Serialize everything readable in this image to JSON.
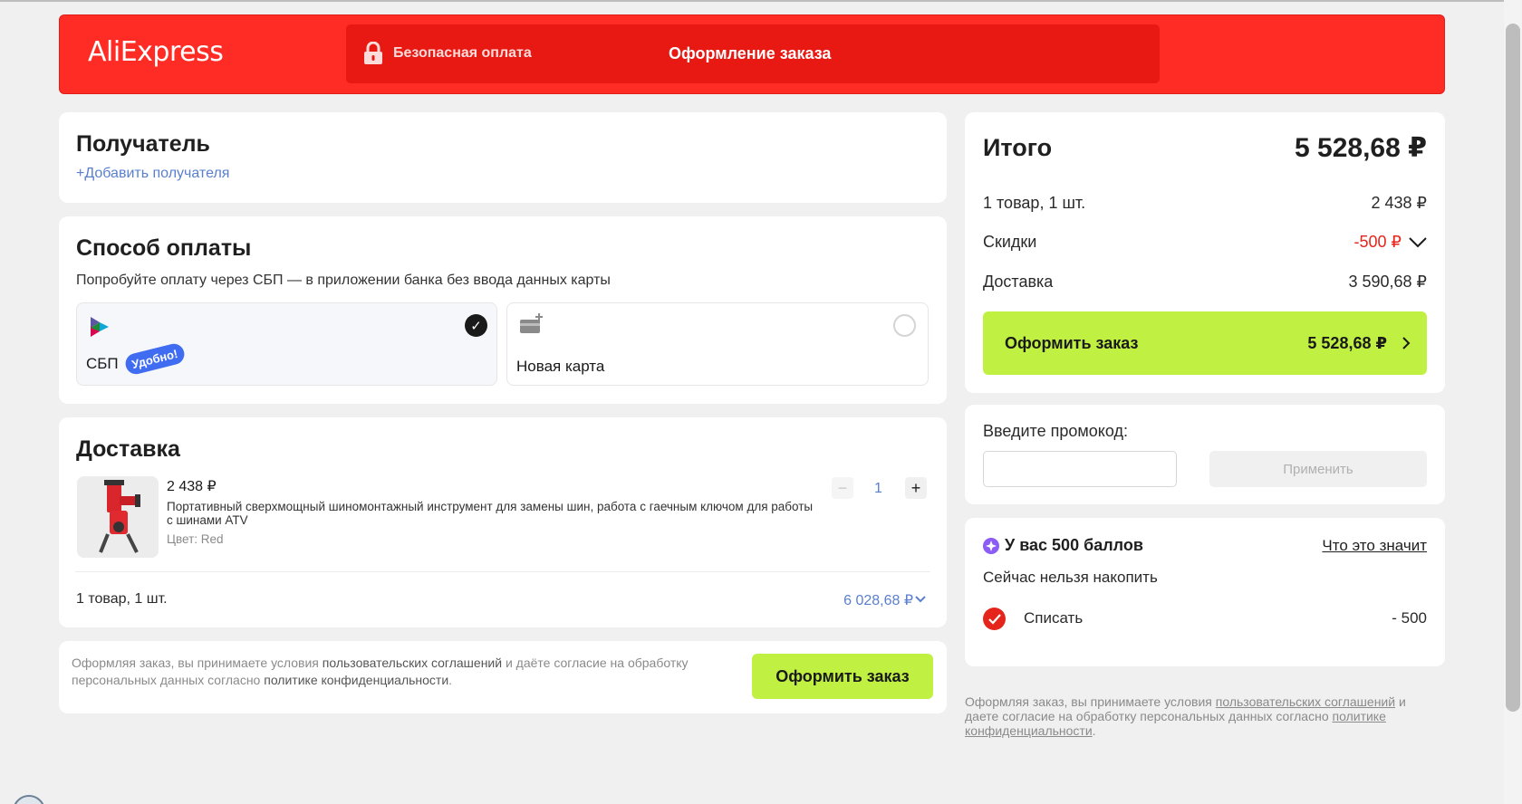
{
  "header": {
    "logo": "AliExpress",
    "secure_payment": "Безопасная оплата",
    "page_title": "Оформление заказа"
  },
  "recipient": {
    "title": "Получатель",
    "add_link": "+Добавить получателя"
  },
  "payment": {
    "title": "Способ оплаты",
    "hint": "Попробуйте оплату через СБП — в приложении банка без ввода данных карты",
    "options": [
      {
        "label": "СБП",
        "badge": "Удобно!",
        "selected": true,
        "icon": "sbp-icon"
      },
      {
        "label": "Новая карта",
        "selected": false,
        "icon": "new-card-icon"
      }
    ]
  },
  "delivery": {
    "title": "Доставка",
    "item": {
      "price": "2 438 ₽",
      "name": "Портативный сверхмощный шиномонтажный инструмент для замены шин, работа с гаечным ключом для работы с шинами ATV",
      "color_label": "Цвет: Red",
      "quantity": "1",
      "minus": "−",
      "plus": "+"
    },
    "summary_count": "1 товар, 1 шт.",
    "summary_total": "6 028,68 ₽"
  },
  "agreement": {
    "text_1": "Оформляя заказ, вы принимаете условия ",
    "link_1": "пользовательских соглашений",
    "text_2": " и даёте согласие на обработку персональных данных согласно ",
    "link_2": "политике конфиденциальности",
    "text_3": ".",
    "button": "Оформить заказ"
  },
  "summary": {
    "title": "Итого",
    "total": "5 528,68 ₽",
    "rows": [
      {
        "label": "1 товар, 1 шт.",
        "value": "2 438 ₽"
      },
      {
        "label": "Скидки",
        "value": "-500 ₽"
      },
      {
        "label": "Доставка",
        "value": "3 590,68 ₽"
      }
    ],
    "button_label": "Оформить заказ",
    "button_amount": "5 528,68 ₽"
  },
  "promo": {
    "label": "Введите промокод:",
    "input_value": "",
    "input_placeholder": "",
    "apply": "Применить"
  },
  "points": {
    "title": "У вас 500 баллов",
    "what_link": "Что это значит",
    "note": "Сейчас нельзя накопить",
    "spend_label": "Списать",
    "spend_value": "- 500"
  },
  "legal_right": {
    "text_1": "Оформляя заказ, вы принимаете условия ",
    "link_1": "пользовательских соглашений",
    "text_2": " и даете согласие на обработку персональных данных согласно ",
    "link_2": "политике конфиденциальности",
    "text_3": "."
  },
  "colors": {
    "brand_red": "#fe2c24",
    "accent_green": "#c0f041",
    "discount_red": "#e5251c",
    "link_blue": "#5a7fcf"
  }
}
